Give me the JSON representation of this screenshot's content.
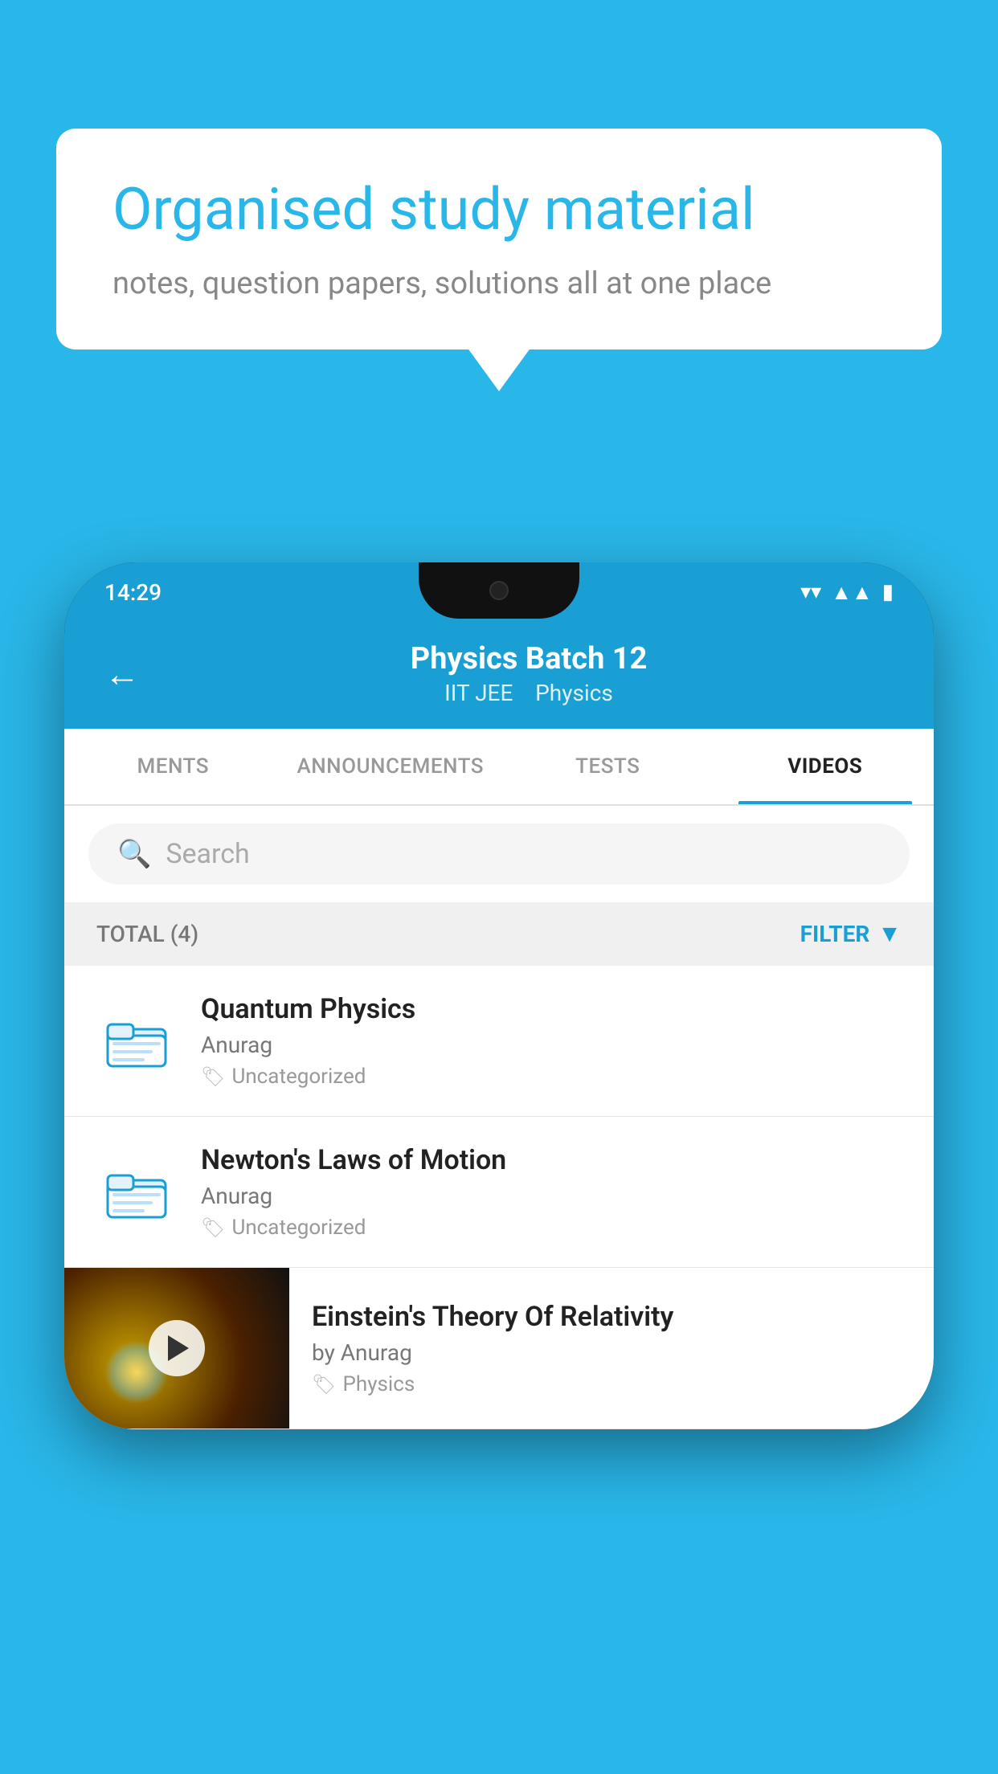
{
  "background_color": "#29b6e8",
  "speech_bubble": {
    "title": "Organised study material",
    "subtitle": "notes, question papers, solutions all at one place"
  },
  "phone": {
    "status_bar": {
      "time": "14:29",
      "icons": [
        "wifi",
        "signal",
        "battery"
      ]
    },
    "app_bar": {
      "title": "Physics Batch 12",
      "subtitle_part1": "IIT JEE",
      "subtitle_part2": "Physics",
      "back_label": "←"
    },
    "tabs": [
      {
        "label": "MENTS",
        "active": false
      },
      {
        "label": "ANNOUNCEMENTS",
        "active": false
      },
      {
        "label": "TESTS",
        "active": false
      },
      {
        "label": "VIDEOS",
        "active": true
      }
    ],
    "search": {
      "placeholder": "Search"
    },
    "filter_bar": {
      "total_label": "TOTAL (4)",
      "filter_label": "FILTER"
    },
    "video_items": [
      {
        "id": 1,
        "title": "Quantum Physics",
        "author": "Anurag",
        "tag": "Uncategorized",
        "type": "folder"
      },
      {
        "id": 2,
        "title": "Newton's Laws of Motion",
        "author": "Anurag",
        "tag": "Uncategorized",
        "type": "folder"
      },
      {
        "id": 3,
        "title": "Einstein's Theory Of Relativity",
        "author": "by Anurag",
        "tag": "Physics",
        "type": "video"
      }
    ]
  }
}
